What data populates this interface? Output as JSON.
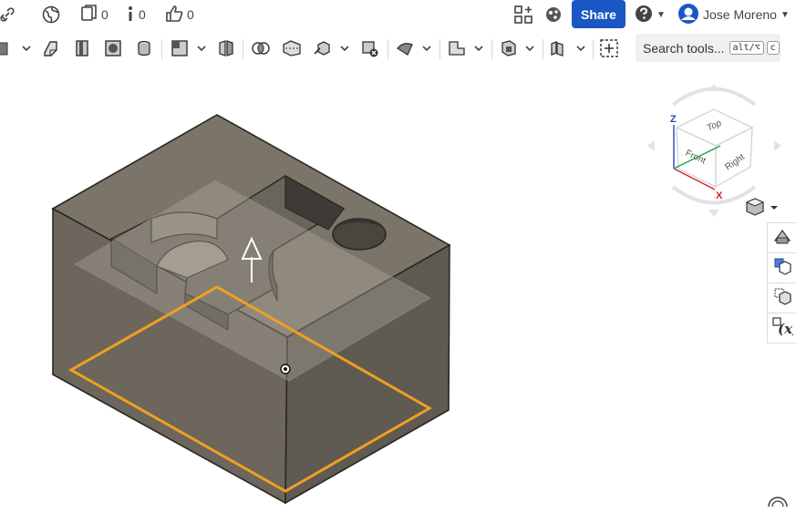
{
  "topbar": {
    "copies_count": "0",
    "info_count": "0",
    "likes_count": "0",
    "share_label": "Share",
    "user_name": "Jose Moreno"
  },
  "toolbar": {
    "search_label": "Search tools...",
    "shortcut_key1": "alt/⌥",
    "shortcut_key2": "c"
  },
  "view_cube": {
    "axis_z": "Z",
    "axis_x": "X",
    "face_top": "Top",
    "face_front": "Front",
    "face_right": "Right"
  },
  "colors": {
    "brand": "#1b57c4",
    "selection": "#f0a020",
    "model_top": "#7b7569",
    "model_front": "#6c665c",
    "model_side": "#5f5a52"
  },
  "icons": [
    "link-icon",
    "globe-icon",
    "copies-icon",
    "info-icon",
    "like-icon",
    "app-store-icon",
    "learning-icon",
    "help-icon",
    "user-avatar-icon",
    "view-cube-icon",
    "render-mode-icon",
    "section-view-icon",
    "named-views-icon",
    "variables-icon"
  ]
}
